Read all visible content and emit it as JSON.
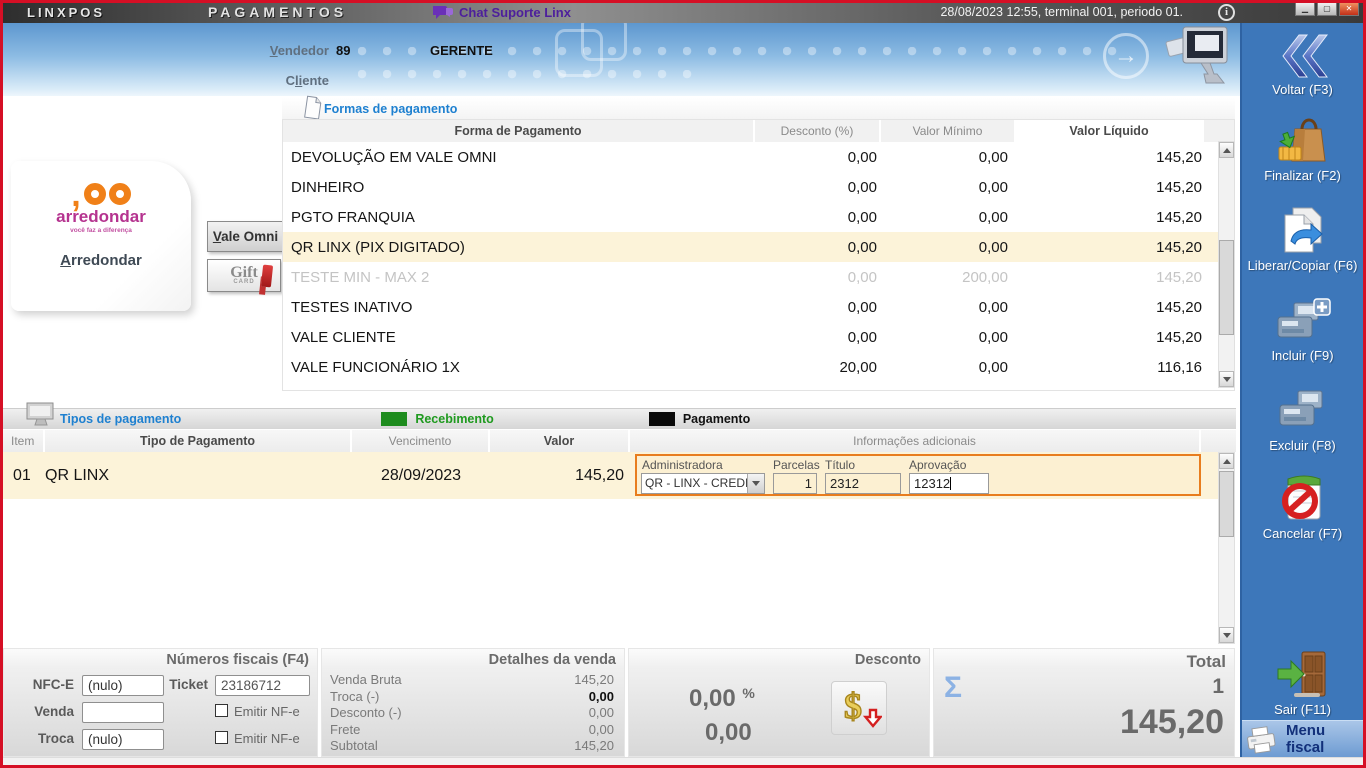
{
  "colors": {
    "frame_red": "#d50f25",
    "accent_orange": "#e87d1e",
    "selected_row_cream": "#fcf3d9",
    "sidebar_blue": "#3d77ba",
    "section_title_blue": "#1e80d0",
    "receive_green": "#1f9a1f",
    "chat_purple": "#4d1f9c"
  },
  "titlebar": {
    "app_name": "LINXPOS",
    "page_title": "PAGAMENTOS",
    "chat_label": "Chat Suporte Linx",
    "session_info": "28/08/2023 12:55, terminal 001, periodo 01."
  },
  "header": {
    "vendedor_mn": "V",
    "vendedor_rest": "endedor",
    "vendedor_code": "89",
    "vendedor_name": "GERENTE",
    "cliente_pre": "C",
    "cliente_mn": "li",
    "cliente_rest": "ente"
  },
  "left_panel": {
    "logo_comma": ",",
    "logo_name": "arredondar",
    "logo_tagline": "você faz a diferença",
    "arredondar_mn": "A",
    "arredondar_rest": "rredondar",
    "vale_omni_mn": "V",
    "vale_omni_rest": "ale Omni",
    "gift_text": "Gift",
    "gift_sub": "CARD"
  },
  "payment_methods": {
    "title": "Formas de pagamento",
    "col_name": "Forma de Pagamento",
    "col_discount": "Desconto (%)",
    "col_min": "Valor Mínimo",
    "col_net": "Valor Líquido",
    "rows": [
      {
        "name": "DEVOLUÇÃO EM VALE OMNI",
        "discount": "0,00",
        "min": "0,00",
        "net": "145,20",
        "state": "normal"
      },
      {
        "name": "DINHEIRO",
        "discount": "0,00",
        "min": "0,00",
        "net": "145,20",
        "state": "normal"
      },
      {
        "name": "PGTO FRANQUIA",
        "discount": "0,00",
        "min": "0,00",
        "net": "145,20",
        "state": "normal"
      },
      {
        "name": "QR LINX (PIX DIGITADO)",
        "discount": "0,00",
        "min": "0,00",
        "net": "145,20",
        "state": "selected"
      },
      {
        "name": "TESTE MIN - MAX 2",
        "discount": "0,00",
        "min": "200,00",
        "net": "145,20",
        "state": "disabled"
      },
      {
        "name": "TESTES INATIVO",
        "discount": "0,00",
        "min": "0,00",
        "net": "145,20",
        "state": "normal"
      },
      {
        "name": "VALE CLIENTE",
        "discount": "0,00",
        "min": "0,00",
        "net": "145,20",
        "state": "normal"
      },
      {
        "name": "VALE FUNCIONÁRIO 1X",
        "discount": "20,00",
        "min": "0,00",
        "net": "116,16",
        "state": "normal"
      }
    ]
  },
  "payment_types": {
    "title": "Tipos de pagamento",
    "legend_receive": "Recebimento",
    "legend_pay": "Pagamento",
    "col_item": "Item",
    "col_type": "Tipo de Pagamento",
    "col_due": "Vencimento",
    "col_value": "Valor",
    "col_info": "Informações adicionais",
    "row": {
      "item": "01",
      "type": "QR LINX",
      "due": "28/09/2023",
      "value": "145,20",
      "admin_label": "Administradora",
      "admin_value": "QR - LINX - CREDITO",
      "parcelas_label": "Parcelas",
      "parcelas_value": "1",
      "titulo_label": "Título",
      "titulo_value": "2312",
      "aprovacao_label": "Aprovação",
      "aprovacao_value": "12312"
    }
  },
  "fiscal": {
    "title": "Números fiscais (F4)",
    "nfce_label": "NFC-E",
    "nfce_value": "(nulo)",
    "ticket_label": "Ticket",
    "ticket_value": "23186712",
    "venda_label": "Venda",
    "venda_value": "",
    "troca_label": "Troca",
    "troca_value": "(nulo)",
    "emitir_nfe_label": "Emitir NF-e"
  },
  "sale_details": {
    "title": "Detalhes da venda",
    "rows": [
      {
        "label": "Venda Bruta",
        "value": "145,20"
      },
      {
        "label": "Troca (-)",
        "value": "0,00"
      },
      {
        "label": "Desconto (-)",
        "value": "0,00"
      },
      {
        "label": "Frete",
        "value": "0,00"
      },
      {
        "label": "Subtotal",
        "value": "145,20"
      }
    ]
  },
  "discount_panel": {
    "title": "Desconto",
    "percent": "0,00",
    "percent_sign": "%",
    "value": "0,00"
  },
  "total_panel": {
    "title": "Total",
    "sigma": "Σ",
    "count": "1",
    "value": "145,20"
  },
  "sidebar": {
    "buttons": [
      {
        "label": "Voltar (F3)"
      },
      {
        "label": "Finalizar (F2)"
      },
      {
        "label": "Liberar/Copiar (F6)"
      },
      {
        "label": "Incluir (F9)"
      },
      {
        "label": "Excluir (F8)"
      },
      {
        "label": "Cancelar (F7)"
      },
      {
        "label": "Sair (F11)"
      }
    ],
    "menu_fiscal": "Menu fiscal"
  }
}
